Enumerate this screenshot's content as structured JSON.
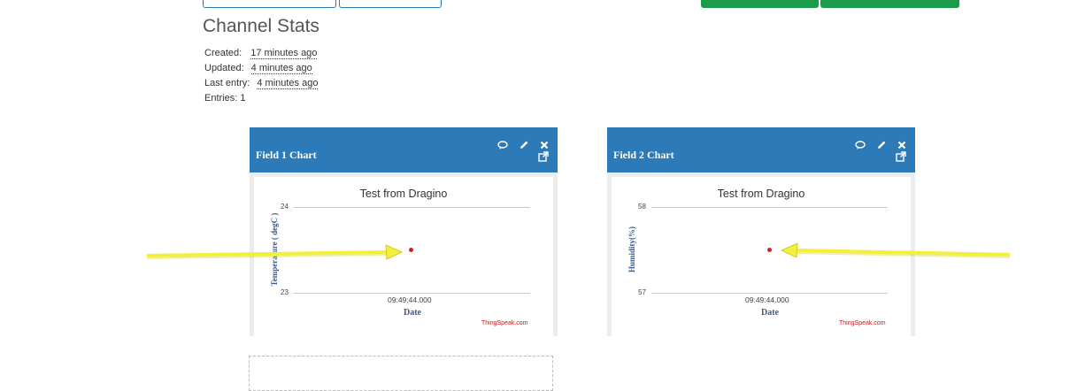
{
  "page": {
    "title": "Channel Stats",
    "stats": [
      {
        "label": "Created:",
        "value": "17 minutes ago"
      },
      {
        "label": "Updated:",
        "value": "4 minutes ago"
      },
      {
        "label": "Last entry:",
        "value": "4 minutes ago"
      },
      {
        "label": "Entries: 1",
        "value": ""
      }
    ]
  },
  "colors": {
    "header": "#2c7ab7",
    "point": "#d62020",
    "credit": "#c41a1a",
    "annotation_arrow": "#f4f03a"
  },
  "icons": [
    "comment-icon",
    "pencil-icon",
    "close-icon",
    "external-link-icon"
  ],
  "cards": [
    {
      "header": "Field 1 Chart",
      "chart_title": "Test from Dragino",
      "ylabel": "Temperature ( degC )",
      "xlabel": "Date",
      "yticks": [
        "24",
        "23"
      ],
      "xtick": "09:49:44.000",
      "credit": "ThingSpeak.com"
    },
    {
      "header": "Field 2 Chart",
      "chart_title": "Test from Dragino",
      "ylabel": "Humidity(%)",
      "xlabel": "Date",
      "yticks": [
        "58",
        "57"
      ],
      "xtick": "09:49:44.000",
      "credit": "ThingSpeak.com"
    }
  ],
  "chart_data": [
    {
      "type": "scatter",
      "title": "Test from Dragino",
      "xlabel": "Date",
      "ylabel": "Temperature ( degC )",
      "ylim": [
        23,
        24
      ],
      "x": [
        "09:49:44.000"
      ],
      "y": [
        23.5
      ]
    },
    {
      "type": "scatter",
      "title": "Test from Dragino",
      "xlabel": "Date",
      "ylabel": "Humidity(%)",
      "ylim": [
        57,
        58
      ],
      "x": [
        "09:49:44.000"
      ],
      "y": [
        57.5
      ]
    }
  ]
}
